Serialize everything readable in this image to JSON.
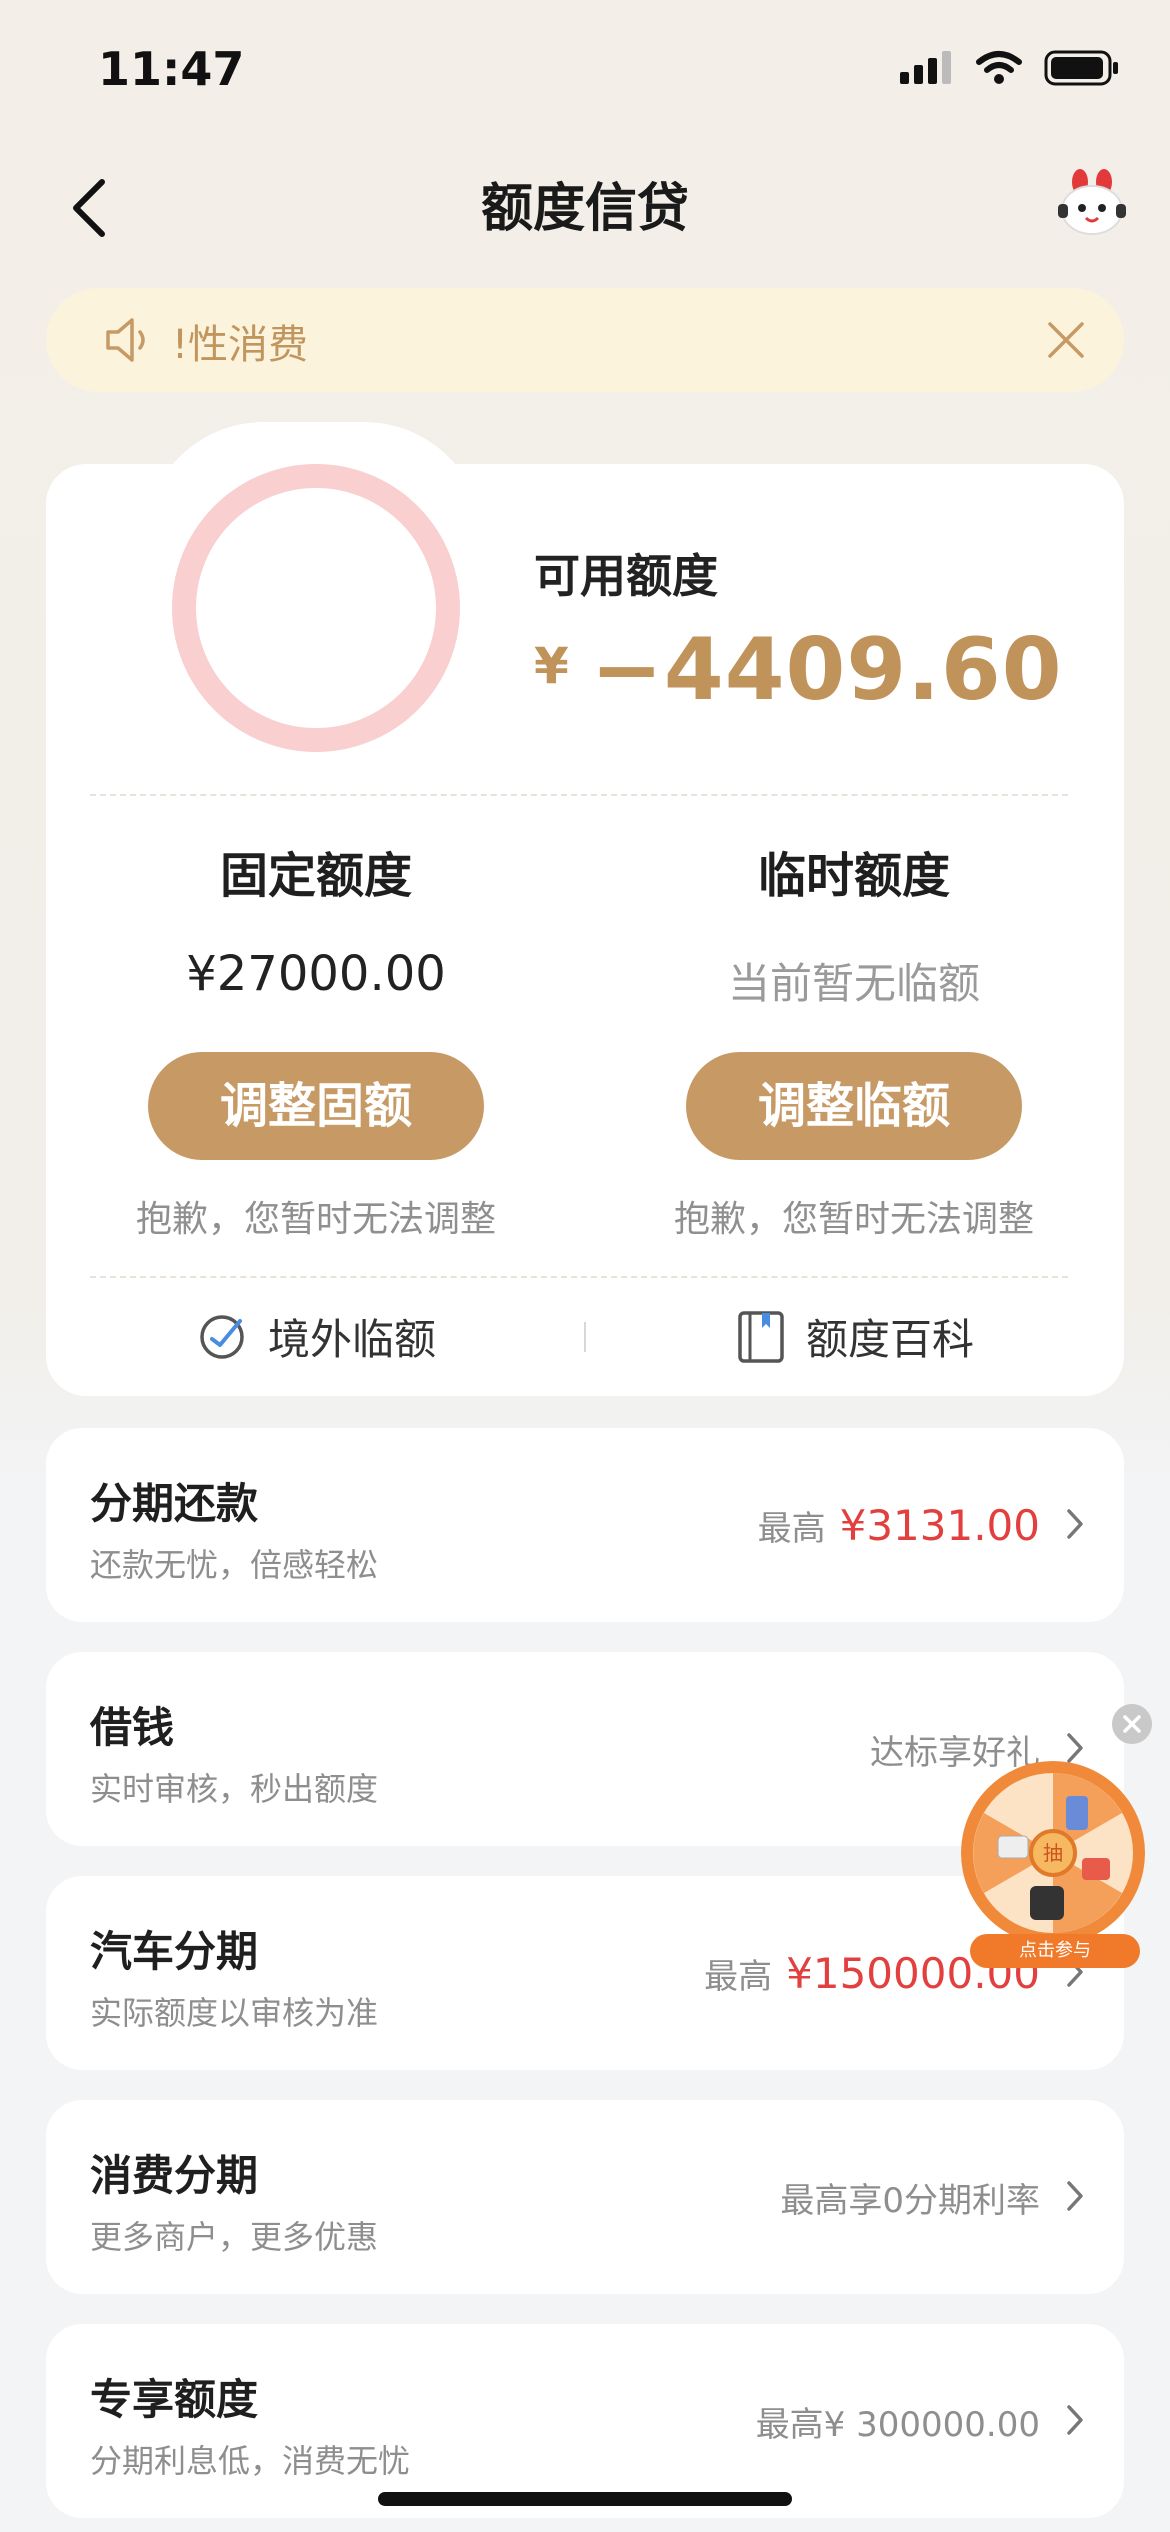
{
  "status_bar": {
    "time": "11:47"
  },
  "nav": {
    "title": "额度信贷"
  },
  "notice": {
    "text": "!性消费"
  },
  "credit": {
    "available_label": "可用额度",
    "currency": "¥",
    "available_amount": "−4409.60",
    "fixed": {
      "title": "固定额度",
      "value": "¥27000.00",
      "button": "调整固额",
      "note": "抱歉，您暂时无法调整"
    },
    "temp": {
      "title": "临时额度",
      "value": "当前暂无临额",
      "button": "调整临额",
      "note": "抱歉，您暂时无法调整"
    },
    "links": {
      "overseas": "境外临额",
      "wiki": "额度百科"
    }
  },
  "rows": [
    {
      "title": "分期还款",
      "subtitle": "还款无忧，倍感轻松",
      "prefix": "最高",
      "amount": "¥3131.00"
    },
    {
      "title": "借钱",
      "subtitle": "实时审核，秒出额度",
      "tag": "达标享好礼"
    },
    {
      "title": "汽车分期",
      "subtitle": "实际额度以审核为准",
      "prefix": "最高",
      "amount": "¥150000.00"
    },
    {
      "title": "消费分期",
      "subtitle": "更多商户，更多优惠",
      "tag": "最高享0分期利率"
    },
    {
      "title": "专享额度",
      "subtitle": "分期利息低，消费无忧",
      "tag": "最高¥ 300000.00"
    }
  ],
  "lucky_wheel": {
    "center": "抽",
    "banner": "点击参与"
  },
  "colors": {
    "accent_gold": "#c79a65",
    "amount_gold": "#c0935b",
    "red": "#e2403e",
    "ring_pink": "#f9cfcf"
  }
}
